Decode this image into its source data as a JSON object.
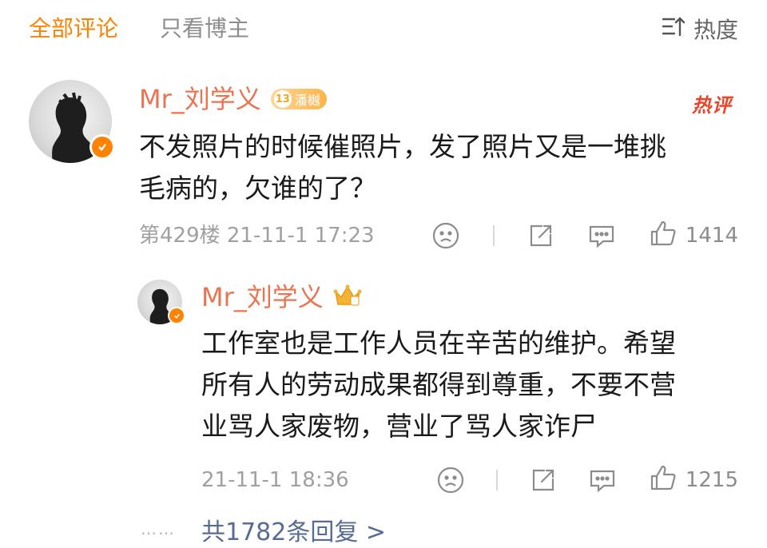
{
  "tabs": {
    "all": "全部评论",
    "owner_only": "只看博主",
    "sort": "热度"
  },
  "comment": {
    "username": "Mr_刘学义",
    "level": "13",
    "badge_text": "潘樾",
    "hot_label": "热评",
    "text_line1": "不发照片的时候催照片，发了照片又是一堆挑",
    "text_line2": "毛病的，欠谁的了？",
    "meta": "第429楼 21-11-1 17:23",
    "likes": "1414"
  },
  "reply": {
    "username": "Mr_刘学义",
    "text_line1": "工作室也是工作人员在辛苦的维护。希望",
    "text_line2": "所有人的劳动成果都得到尊重，不要不营",
    "text_line3": "业骂人家废物，营业了骂人家诈尸",
    "meta": "21-11-1 18:36",
    "likes": "1215"
  },
  "more": {
    "dots": "……",
    "label": "共1782条回复 >"
  },
  "colors": {
    "accent": "#ff8200",
    "username": "#eb7350",
    "link": "#576b95"
  }
}
